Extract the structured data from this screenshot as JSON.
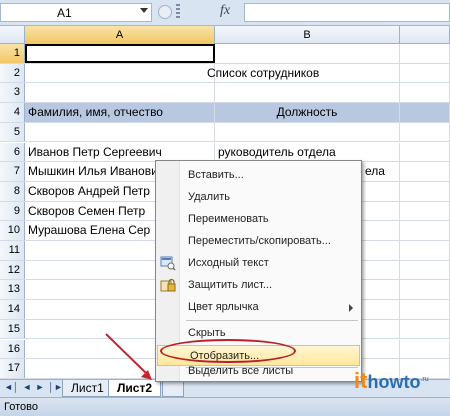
{
  "formula_bar": {
    "name_box": "A1",
    "fx_label": "fx"
  },
  "columns": [
    "A",
    "B"
  ],
  "rows": [
    {
      "num": "1",
      "a": "",
      "b": ""
    },
    {
      "num": "2",
      "a": "",
      "b": "Список сотрудников"
    },
    {
      "num": "3",
      "a": "",
      "b": ""
    },
    {
      "num": "4",
      "a": "Фамилия, имя, отчество",
      "b": "Должность"
    },
    {
      "num": "5",
      "a": "",
      "b": ""
    },
    {
      "num": "6",
      "a": "Иванов Петр Сергеевич",
      "b": "руководитель отдела"
    },
    {
      "num": "7",
      "a": "Мышкин Илья Иванович",
      "b": "ела"
    },
    {
      "num": "8",
      "a": "Скворов Андрей Петр",
      "b": ""
    },
    {
      "num": "9",
      "a": "Скворов Семен Петр",
      "b": ""
    },
    {
      "num": "10",
      "a": "Мурашова Елена Сер",
      "b": ""
    },
    {
      "num": "11",
      "a": "",
      "b": ""
    },
    {
      "num": "12",
      "a": "",
      "b": ""
    },
    {
      "num": "13",
      "a": "",
      "b": ""
    },
    {
      "num": "14",
      "a": "",
      "b": ""
    },
    {
      "num": "15",
      "a": "",
      "b": ""
    },
    {
      "num": "16",
      "a": "",
      "b": ""
    },
    {
      "num": "17",
      "a": "",
      "b": ""
    }
  ],
  "context_menu": {
    "items": [
      {
        "label": "Вставить...",
        "icon": ""
      },
      {
        "label": "Удалить",
        "icon": ""
      },
      {
        "label": "Переименовать",
        "icon": ""
      },
      {
        "label": "Переместить/скопировать...",
        "icon": ""
      },
      {
        "label": "Исходный текст",
        "icon": "view-code-icon"
      },
      {
        "label": "Защитить лист...",
        "icon": "lock-icon"
      },
      {
        "label": "Цвет ярлычка",
        "icon": "",
        "submenu": true
      },
      {
        "label": "Скрыть",
        "icon": ""
      },
      {
        "label": "Отобразить...",
        "icon": "",
        "highlighted": true
      },
      {
        "label": "Выделить все листы",
        "icon": ""
      }
    ]
  },
  "sheet_tabs": {
    "tabs": [
      "Лист1",
      "Лист2"
    ],
    "active": "Лист2"
  },
  "status_bar": {
    "text": "Готово"
  },
  "logo": {
    "part1": "it",
    "part2": "howto",
    "suffix": ".ru"
  },
  "colors": {
    "selection_header": "#f2c764",
    "header_row_fill": "#b7c8e0",
    "highlight_oval": "#b8202a",
    "arrow": "#c0282e"
  }
}
